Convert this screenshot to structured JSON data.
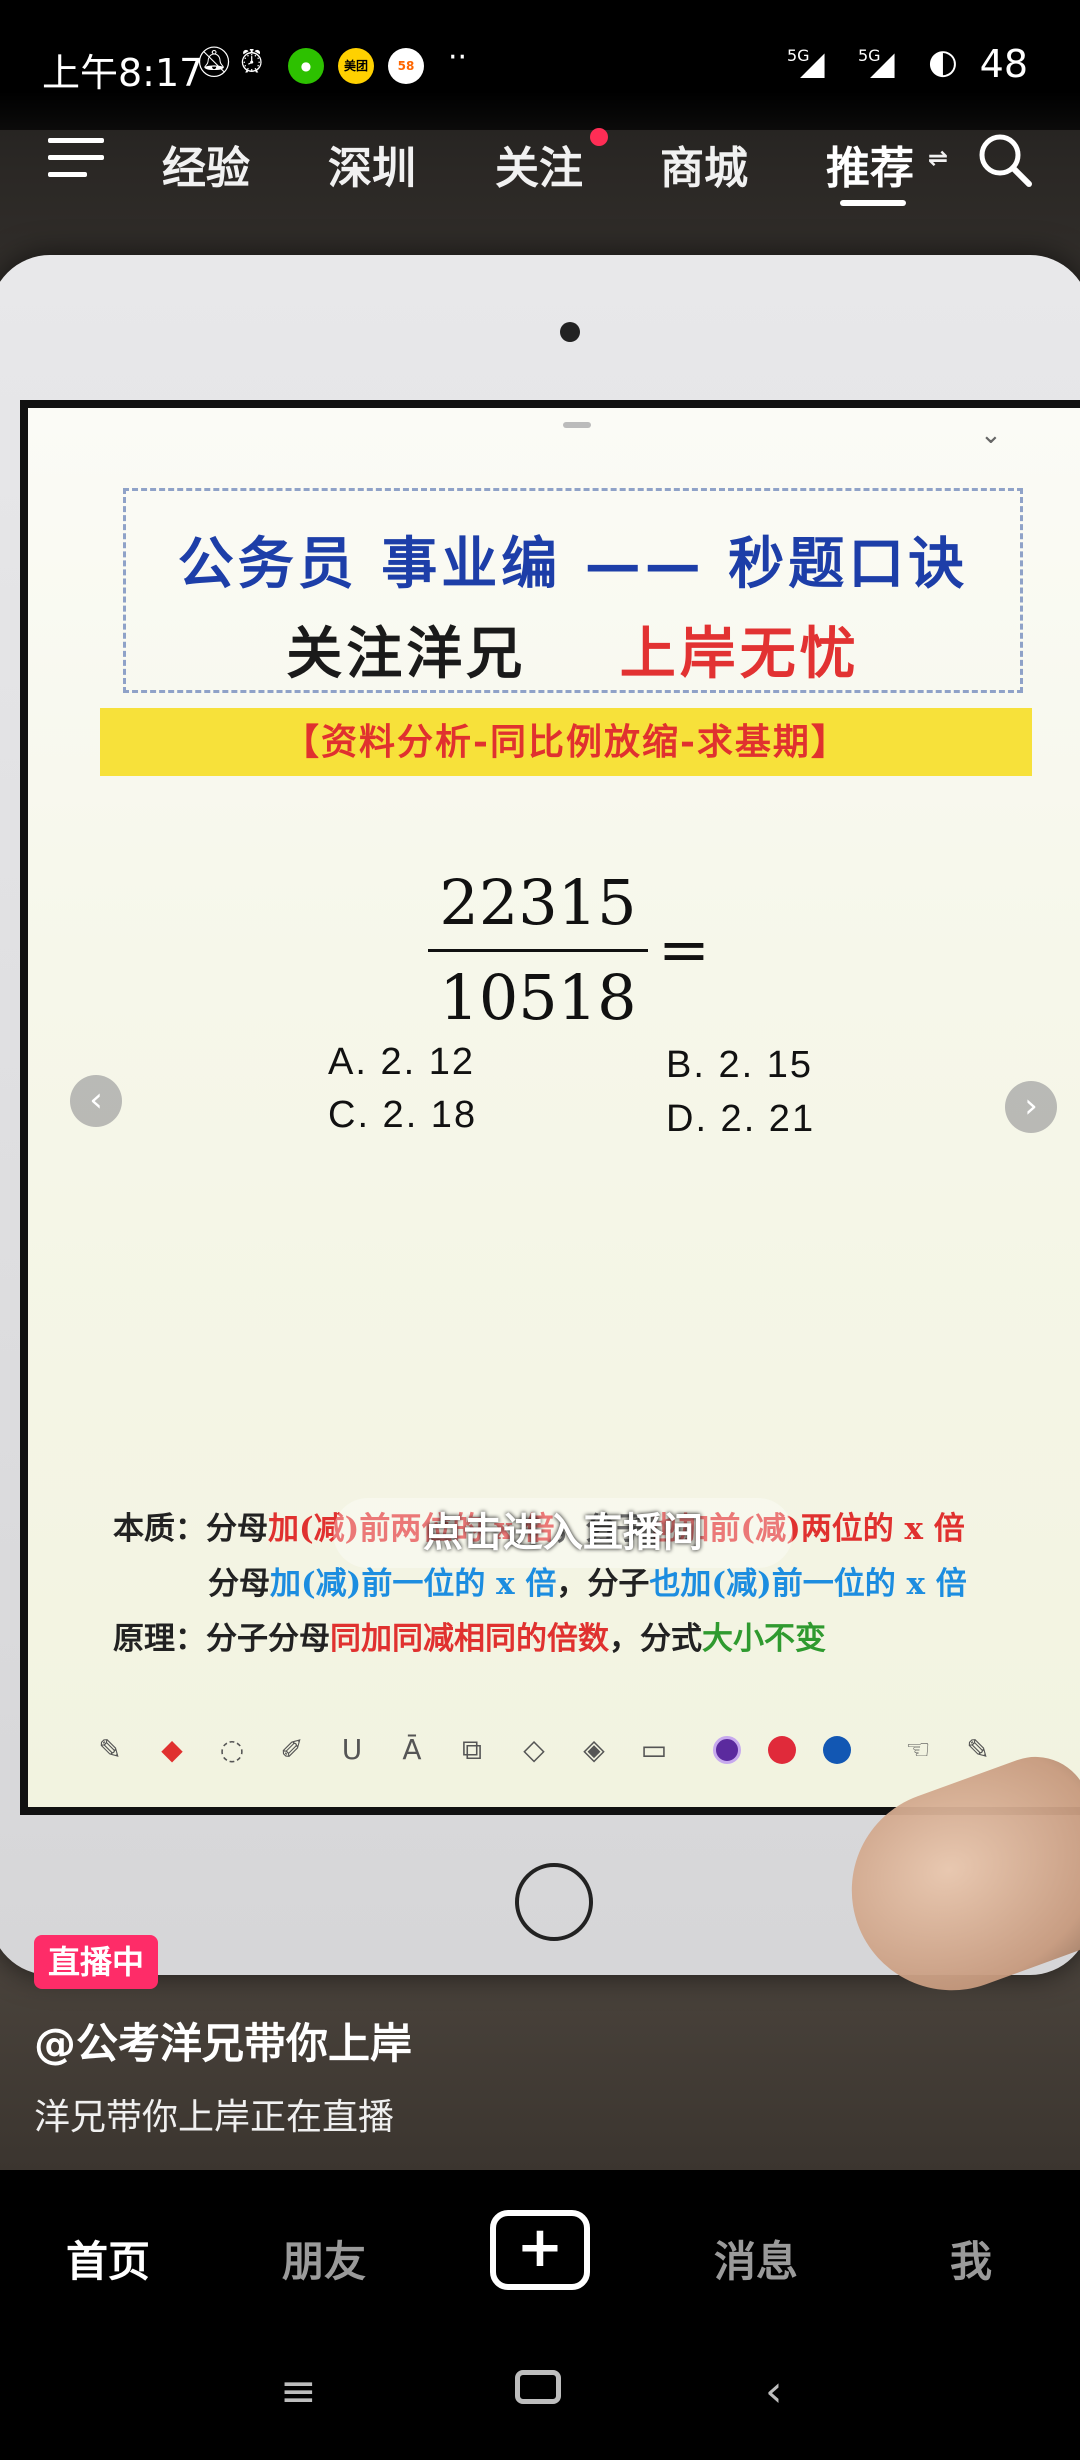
{
  "status_bar": {
    "time": "上午8:17",
    "app_badges": [
      {
        "name": "wechat",
        "label": "",
        "color": "#2dc100"
      },
      {
        "name": "meituan",
        "label": "美团",
        "color": "#ffd100"
      },
      {
        "name": "58",
        "label": "58",
        "color": "#ffffff"
      }
    ],
    "more": "··",
    "signal_1": "5G",
    "signal_2": "5G",
    "battery": "48"
  },
  "top_nav": {
    "tabs": [
      {
        "label": "经验"
      },
      {
        "label": "深圳"
      },
      {
        "label": "关注"
      },
      {
        "label": "商城"
      },
      {
        "label": "推荐"
      }
    ],
    "active_tab": "推荐"
  },
  "document": {
    "title_line1": "公务员  事业编 —— 秒题口诀",
    "title_line2_a": "关注洋兄",
    "title_line2_b": "上岸无忧",
    "banner": "【资料分析-同比例放缩-求基期】",
    "numerator": "22315",
    "denominator": "10518",
    "equals": "=",
    "options": {
      "a": "A. 2. 12",
      "b": "B. 2. 15",
      "c": "C. 2. 18",
      "d": "D. 2. 21"
    },
    "rules": {
      "essence_label": "本质：",
      "essence_1_a": "分母",
      "essence_1_b": "加(减)前两位的 x 倍",
      "essence_1_c": "，分子",
      "essence_1_d": "也加前(减)两位的 x 倍",
      "essence_2_a": "分母",
      "essence_2_b": "加(减)前一位的 x 倍",
      "essence_2_c": "，分子",
      "essence_2_d": "也加(减)前一位的 x 倍",
      "principle_label": "原理：",
      "principle_a": "分子分母",
      "principle_b": "同加同减相同的倍数",
      "principle_c": "，分式",
      "principle_d": "大小不变"
    },
    "live_overlay": "点击进入直播间",
    "toolbar_colors": [
      "#5b2a9e",
      "#e02a3a",
      "#1257b3"
    ]
  },
  "live": {
    "badge": "直播中",
    "author": "@公考洋兄带你上岸",
    "description": "洋兄带你上岸正在直播"
  },
  "bottom_tabs": {
    "home": "首页",
    "friends": "朋友",
    "plus": "+",
    "messages": "消息",
    "me": "我"
  }
}
